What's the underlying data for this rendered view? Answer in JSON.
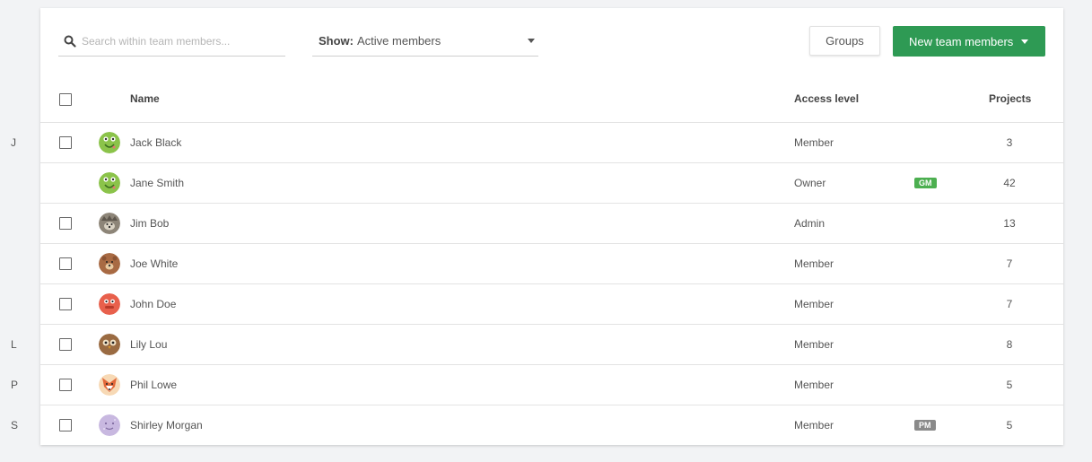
{
  "letters": [
    "J",
    "L",
    "P",
    "S"
  ],
  "toolbar": {
    "search_placeholder": "Search within team members...",
    "show_label": "Show:",
    "show_value": "Active members",
    "groups_label": "Groups",
    "new_label": "New team members"
  },
  "table": {
    "headers": {
      "name": "Name",
      "access": "Access level",
      "projects": "Projects"
    },
    "rows": [
      {
        "name": "Jack Black",
        "access": "Member",
        "projects": "3",
        "badge": "",
        "avatar": "green-lizard-avatar"
      },
      {
        "name": "Jane Smith",
        "access": "Owner",
        "projects": "42",
        "badge": "GM",
        "avatar": "green-lizard-avatar"
      },
      {
        "name": "Jim Bob",
        "access": "Admin",
        "projects": "13",
        "badge": "",
        "avatar": "hedgehog-avatar"
      },
      {
        "name": "Joe White",
        "access": "Member",
        "projects": "7",
        "badge": "",
        "avatar": "bear-avatar"
      },
      {
        "name": "John Doe",
        "access": "Member",
        "projects": "7",
        "badge": "",
        "avatar": "red-monster-avatar"
      },
      {
        "name": "Lily Lou",
        "access": "Member",
        "projects": "8",
        "badge": "",
        "avatar": "owl-avatar"
      },
      {
        "name": "Phil Lowe",
        "access": "Member",
        "projects": "5",
        "badge": "",
        "avatar": "fox-avatar"
      },
      {
        "name": "Shirley Morgan",
        "access": "Member",
        "projects": "5",
        "badge": "PM",
        "avatar": "purple-creature-avatar"
      }
    ]
  },
  "colors": {
    "primary": "#2e9a54",
    "gm_badge": "#4caf50",
    "pm_badge": "#8a8a8a"
  }
}
